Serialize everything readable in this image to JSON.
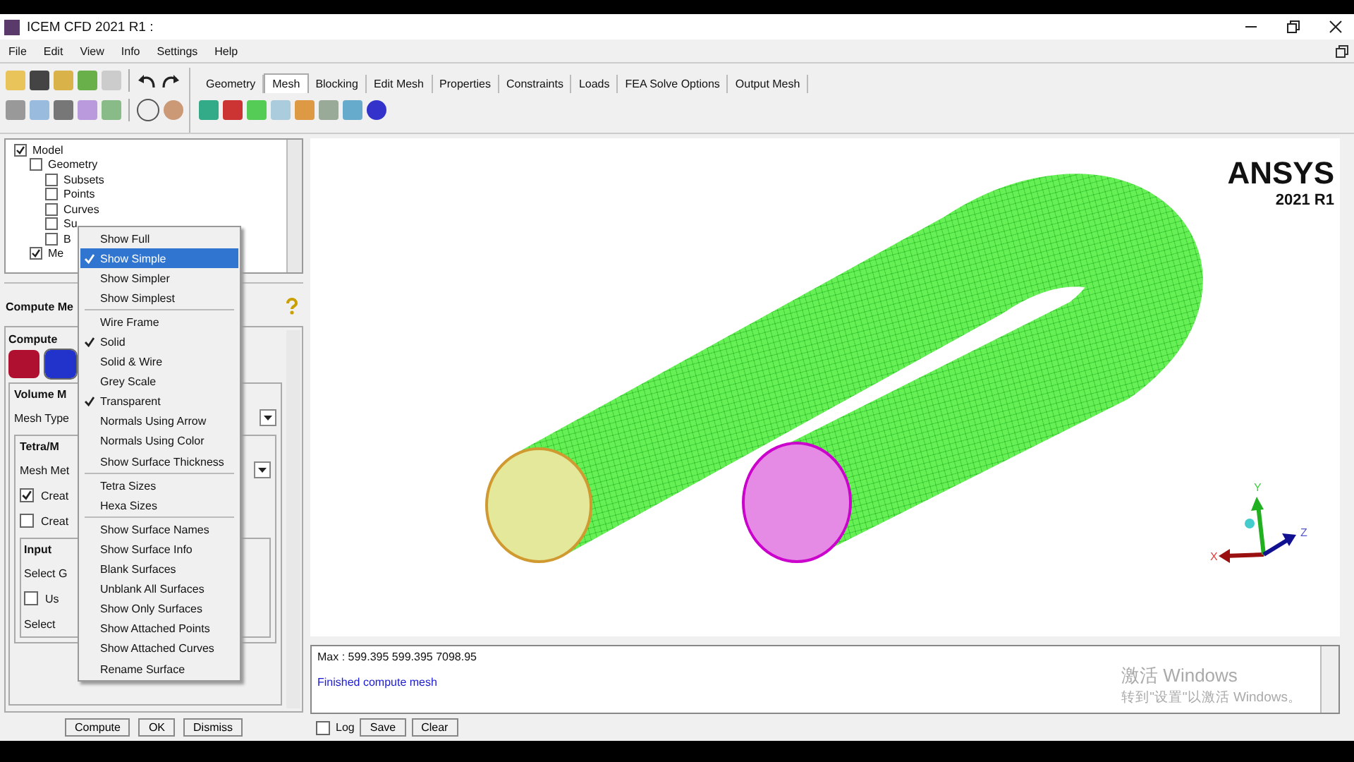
{
  "window": {
    "title": "ICEM CFD 2021 R1 :"
  },
  "menu": [
    "File",
    "Edit",
    "View",
    "Info",
    "Settings",
    "Help"
  ],
  "tabs": [
    {
      "label": "Geometry",
      "selected": false
    },
    {
      "label": "Mesh",
      "selected": true
    },
    {
      "label": "Blocking",
      "selected": false
    },
    {
      "label": "Edit Mesh",
      "selected": false
    },
    {
      "label": "Properties",
      "selected": false
    },
    {
      "label": "Constraints",
      "selected": false
    },
    {
      "label": "Loads",
      "selected": false
    },
    {
      "label": "FEA Solve Options",
      "selected": false
    },
    {
      "label": "Output Mesh",
      "selected": false
    }
  ],
  "tree": [
    {
      "label": "Model",
      "checked": true,
      "children": [
        {
          "label": "Geometry",
          "checked": false,
          "children": [
            {
              "label": "Subsets",
              "checked": false
            },
            {
              "label": "Points",
              "checked": false
            },
            {
              "label": "Curves",
              "checked": false
            },
            {
              "label": "Su",
              "checked": false
            },
            {
              "label": "B",
              "checked": false
            }
          ]
        },
        {
          "label": "Me",
          "checked": true
        }
      ]
    }
  ],
  "panel": {
    "title": "Compute Me",
    "group": "Compute",
    "volume_group": "Volume M",
    "mesh_type_label": "Mesh Type",
    "tetra_group": "Tetra/M",
    "mesh_method_label": "Mesh Met",
    "options": [
      {
        "label": "Creat",
        "checked": true
      },
      {
        "label": "Creat",
        "checked": false
      }
    ],
    "input_group": "Input",
    "select_geometry_label": "Select G",
    "use_option": {
      "label": "Us",
      "checked": false
    },
    "select_label": "Select",
    "buttons": [
      "Compute",
      "OK",
      "Dismiss"
    ]
  },
  "context_menu": [
    [
      {
        "label": "Show Full",
        "checked": false,
        "selected": false
      },
      {
        "label": "Show Simple",
        "checked": true,
        "selected": true
      },
      {
        "label": "Show Simpler",
        "checked": false,
        "selected": false
      },
      {
        "label": "Show Simplest",
        "checked": false,
        "selected": false
      }
    ],
    [
      {
        "label": "Wire Frame",
        "checked": false,
        "selected": false
      },
      {
        "label": "Solid",
        "checked": true,
        "selected": false
      },
      {
        "label": "Solid & Wire",
        "checked": false,
        "selected": false
      },
      {
        "label": "Grey Scale",
        "checked": false,
        "selected": false
      },
      {
        "label": "Transparent",
        "checked": true,
        "selected": false
      },
      {
        "label": "Normals Using Arrow",
        "checked": false,
        "selected": false
      },
      {
        "label": "Normals Using Color",
        "checked": false,
        "selected": false
      },
      {
        "label": "Show Surface Thickness",
        "checked": false,
        "selected": false
      }
    ],
    [
      {
        "label": "Tetra Sizes",
        "checked": false,
        "selected": false
      },
      {
        "label": "Hexa Sizes",
        "checked": false,
        "selected": false
      }
    ],
    [
      {
        "label": "Show Surface Names",
        "checked": false,
        "selected": false
      },
      {
        "label": "Show Surface Info",
        "checked": false,
        "selected": false
      },
      {
        "label": "Blank Surfaces",
        "checked": false,
        "selected": false
      },
      {
        "label": "Unblank All Surfaces",
        "checked": false,
        "selected": false
      },
      {
        "label": "Show Only Surfaces",
        "checked": false,
        "selected": false
      },
      {
        "label": "Show Attached Points",
        "checked": false,
        "selected": false
      },
      {
        "label": "Show Attached Curves",
        "checked": false,
        "selected": false
      },
      {
        "label": "Rename Surface",
        "checked": false,
        "selected": false
      }
    ]
  ],
  "viewport": {
    "logo": "ANSYS",
    "version": "2021 R1",
    "axes": [
      "X",
      "Y",
      "Z"
    ]
  },
  "messages": [
    {
      "text": "Max : 599.395 599.395 7098.95",
      "kind": "info"
    },
    {
      "text": "Finished compute mesh",
      "kind": "status"
    }
  ],
  "message_bar": {
    "log": {
      "label": "Log",
      "checked": false
    },
    "buttons": [
      "Save",
      "Clear"
    ]
  },
  "activation_notice": {
    "title": "激活 Windows",
    "subtitle": "转到\"设置\"以激活 Windows。"
  }
}
